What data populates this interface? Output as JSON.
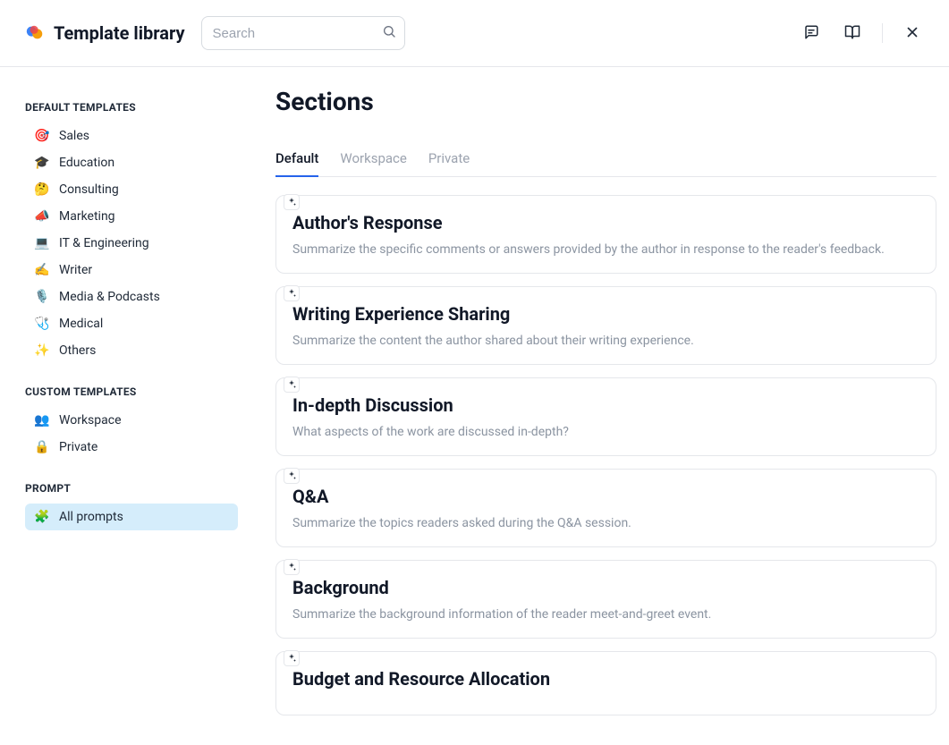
{
  "header": {
    "title": "Template library",
    "search_placeholder": "Search"
  },
  "sidebar": {
    "default_title": "DEFAULT TEMPLATES",
    "default_items": [
      {
        "emoji": "🎯",
        "label": "Sales"
      },
      {
        "emoji": "🎓",
        "label": "Education"
      },
      {
        "emoji": "🤔",
        "label": "Consulting"
      },
      {
        "emoji": "📣",
        "label": "Marketing"
      },
      {
        "emoji": "💻",
        "label": "IT & Engineering"
      },
      {
        "emoji": "✍️",
        "label": "Writer"
      },
      {
        "emoji": "🎙️",
        "label": "Media & Podcasts"
      },
      {
        "emoji": "🩺",
        "label": "Medical"
      },
      {
        "emoji": "✨",
        "label": "Others"
      }
    ],
    "custom_title": "CUSTOM TEMPLATES",
    "custom_items": [
      {
        "emoji": "👥",
        "label": "Workspace"
      },
      {
        "emoji": "🔒",
        "label": "Private"
      }
    ],
    "prompt_title": "PROMPT",
    "prompt_items": [
      {
        "emoji": "🧩",
        "label": "All prompts"
      }
    ]
  },
  "main": {
    "title": "Sections",
    "tabs": [
      {
        "label": "Default",
        "active": true
      },
      {
        "label": "Workspace",
        "active": false
      },
      {
        "label": "Private",
        "active": false
      }
    ],
    "cards": [
      {
        "title": "Author's Response",
        "desc": "Summarize the specific comments or answers provided by the author in response to the reader's feedback."
      },
      {
        "title": "Writing Experience Sharing",
        "desc": "Summarize the content the author shared about their writing experience."
      },
      {
        "title": "In-depth Discussion",
        "desc": "What aspects of the work are discussed in-depth?"
      },
      {
        "title": "Q&A",
        "desc": "Summarize the topics readers asked during the Q&A session."
      },
      {
        "title": "Background",
        "desc": "Summarize the background information of the reader meet-and-greet event."
      },
      {
        "title": "Budget and Resource Allocation",
        "desc": ""
      }
    ]
  }
}
